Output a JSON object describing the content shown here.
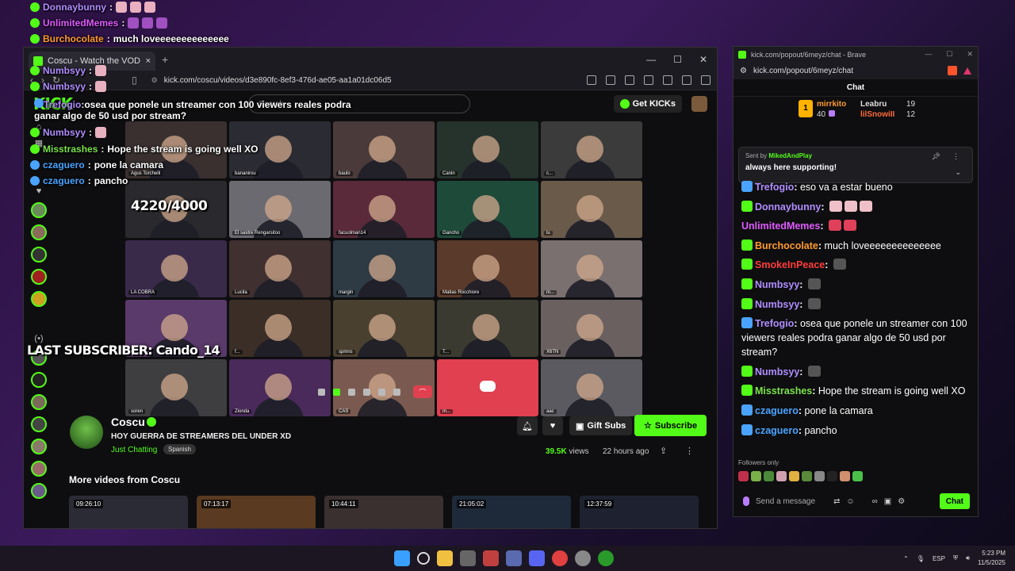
{
  "overlay_chat": [
    {
      "user": "Donnaybunny",
      "text": "",
      "color": "#b08cff"
    },
    {
      "user": "UnlimitedMemes",
      "text": "",
      "color": "#e05aff"
    },
    {
      "user": "Burchocolate",
      "text": "much loveeeeeeeeeeeeee",
      "color": "#ff9a2e"
    },
    {
      "user": "Numbsyy",
      "text": "",
      "color": "#b08cff"
    },
    {
      "user": "Numbsyy",
      "text": "",
      "color": "#b08cff"
    },
    {
      "user": "Trefogio",
      "text": "osea que ponele un streamer con 100 viewers reales podra ganar algo de 50 usd por stream?",
      "color": "#b08cff"
    },
    {
      "user": "Numbsyy",
      "text": "",
      "color": "#b08cff"
    },
    {
      "user": "Misstrashes",
      "text": "Hope the stream is going well XO",
      "color": "#7be24b"
    },
    {
      "user": "czaguero",
      "text": "pone la camara",
      "color": "#4aa3ff"
    },
    {
      "user": "czaguero",
      "text": "pancho",
      "color": "#4aa3ff"
    }
  ],
  "overlay": {
    "counter": "4220/4000",
    "last_sub": "LAST SUBSCRIBER: Cando_14"
  },
  "browser": {
    "tab_title": "Coscu - Watch the VOD on Kick",
    "url": "kick.com/coscu/videos/d3e890fc-8ef3-476d-ae05-aa1a01dc06d5",
    "search_placeholder": "Search",
    "get_kicks": "Get KICKs",
    "logo": "KICK"
  },
  "video_tiles": [
    {
      "label": "Agus Torchelli",
      "color": "#3a3030"
    },
    {
      "label": "bananirou",
      "color": "#2b2b33"
    },
    {
      "label": "baulo",
      "color": "#4a3a3a"
    },
    {
      "label": "Canin",
      "color": "#26332c"
    },
    {
      "label": "c...",
      "color": "#3b3b3b"
    },
    {
      "label": "",
      "color": "#2a2a2e"
    },
    {
      "label": "El sastre Rengarsitoo",
      "color": "#6a6a70"
    },
    {
      "label": "facuolman14",
      "color": "#5a2a3a"
    },
    {
      "label": "Gancho",
      "color": "#1e4a3a"
    },
    {
      "label": "lu",
      "color": "#6a5a4a"
    },
    {
      "label": "LA COBRA",
      "color": "#3a2a4a"
    },
    {
      "label": "Lucila",
      "color": "#403030"
    },
    {
      "label": "margin",
      "color": "#2e3a44"
    },
    {
      "label": "Matias Rocchiore",
      "color": "#5a3a2a"
    },
    {
      "label": "m...",
      "color": "#7a7070"
    },
    {
      "label": "ramanin",
      "color": "#5a3a6a"
    },
    {
      "label": "f...",
      "color": "#3a2e26"
    },
    {
      "label": "spmns",
      "color": "#4a4030"
    },
    {
      "label": "T...",
      "color": "#3a3a30"
    },
    {
      "label": "X6TN",
      "color": "#6a6060"
    },
    {
      "label": "soren",
      "color": "#3e3e40"
    },
    {
      "label": "Zionda",
      "color": "#4a2a5a"
    },
    {
      "label": "CAS",
      "color": "#7a5a50"
    },
    {
      "label": "m...",
      "color": "#e0404f"
    },
    {
      "label": "aac",
      "color": "#5a5a60"
    }
  ],
  "channel": {
    "name": "Coscu",
    "title": "HOY GUERRA DE STREAMERS DEL UNDER XD",
    "category": "Just Chatting",
    "language": "Spanish",
    "gift": "Gift Subs",
    "subscribe": "Subscribe",
    "views": "39.5K",
    "views_label": "views",
    "ago": "22 hours ago",
    "more_videos": "More videos from Coscu"
  },
  "thumbs": [
    "09:26:10",
    "07:13:17",
    "10:44:11",
    "21:05:02",
    "12:37:59"
  ],
  "chat_window": {
    "title": "kick.com/popout/6meyz/chat - Brave",
    "url": "kick.com/popout/6meyz/chat",
    "header": "Chat",
    "leader1_name": "mirrkito",
    "leader1_count": "40",
    "leader2_name": "Leabru",
    "leader2_count": "19",
    "leader3_name": "lilSnowiII",
    "leader3_count": "12",
    "pinned_sent_prefix": "Sent by",
    "pinned_sent_by": "MikedAndPlay",
    "pinned_msg": "always here supporting!",
    "followers_only": "Followers only",
    "input_placeholder": "Send a message",
    "chat_button": "Chat"
  },
  "chat_messages": [
    {
      "user": "Trefogio",
      "text": "eso va a estar bueno",
      "color": "#b08cff"
    },
    {
      "user": "Donnaybunny",
      "text": "",
      "color": "#b08cff"
    },
    {
      "user": "UnlimitedMemes",
      "text": "",
      "color": "#e05aff"
    },
    {
      "user": "Burchocolate",
      "text": "much loveeeeeeeeeeeeee",
      "color": "#ff9a2e"
    },
    {
      "user": "SmokeInPeace",
      "text": "",
      "color": "#ff3b3b"
    },
    {
      "user": "Numbsyy",
      "text": "",
      "color": "#b08cff"
    },
    {
      "user": "Numbsyy",
      "text": "",
      "color": "#b08cff"
    },
    {
      "user": "Trefogio",
      "text": "osea que ponele un streamer con 100 viewers reales podra ganar algo de 50 usd por stream?",
      "color": "#b08cff"
    },
    {
      "user": "Numbsyy",
      "text": "",
      "color": "#b08cff"
    },
    {
      "user": "Misstrashes",
      "text": "Hope the stream is going well XO",
      "color": "#7be24b"
    },
    {
      "user": "czaguero",
      "text": "pone la camara",
      "color": "#4aa3ff"
    },
    {
      "user": "czaguero",
      "text": "pancho",
      "color": "#4aa3ff"
    }
  ],
  "taskbar": {
    "lang": "ESP",
    "time": "5:23 PM",
    "date": "11/5/2025"
  }
}
